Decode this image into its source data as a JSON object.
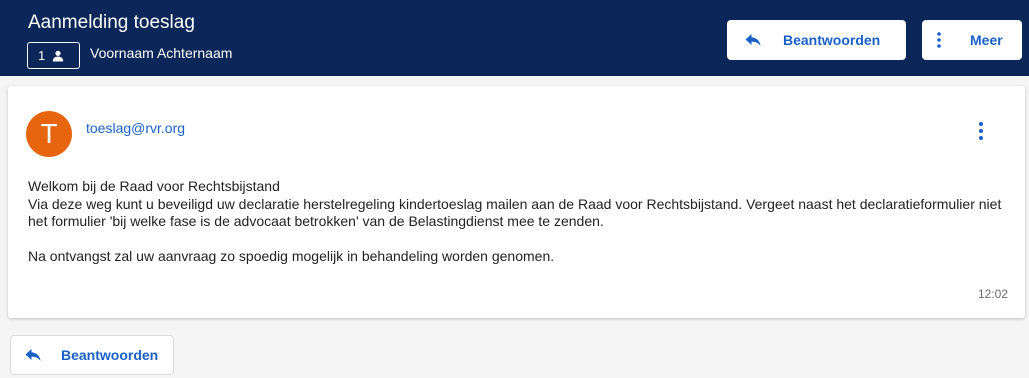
{
  "header": {
    "title": "Aanmelding toeslag",
    "participant_count": "1",
    "recipient": "Voornaam Achternaam",
    "reply_label": "Beantwoorden",
    "more_label": "Meer"
  },
  "message": {
    "avatar_letter": "T",
    "sender": "toeslag@rvr.org",
    "body": [
      "Welkom bij de Raad voor Rechtsbijstand",
      "Via deze weg kunt u beveiligd uw declaratie herstelregeling kindertoeslag mailen aan de Raad voor Rechtsbijstand. Vergeet naast het declaratieformulier niet het formulier 'bij welke fase is de advocaat betrokken' van de Belastingdienst mee te zenden.",
      "Na ontvangst zal uw aanvraag zo spoedig mogelijk in behandeling worden genomen."
    ],
    "time": "12:02"
  },
  "footer": {
    "reply_label": "Beantwoorden"
  },
  "colors": {
    "header_bg": "#0b2659",
    "accent": "#1a61c7",
    "avatar_bg": "#e8650f"
  }
}
